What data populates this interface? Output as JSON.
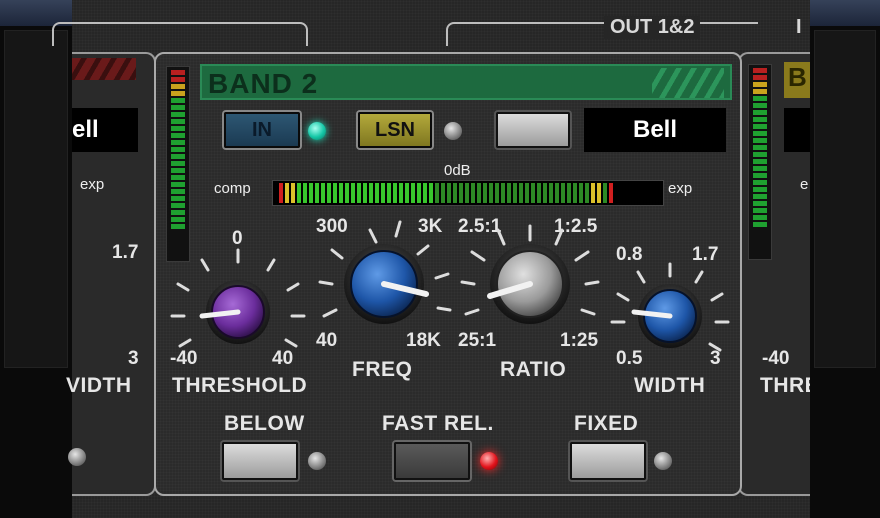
{
  "header": {
    "out_label": "OUT 1&2",
    "next_label_partial": "I"
  },
  "left_band": {
    "mode": "ell",
    "exp_label": "exp",
    "scale_top": "1.7",
    "scale_bottom": "3",
    "name": "VIDTH"
  },
  "right_band": {
    "band_partial": "B",
    "scale_bottom": "-40",
    "name_partial": "THRE",
    "exp_partial": "e"
  },
  "band": {
    "title": "BAND 2",
    "in_label": "IN",
    "lsn_label": "LSN",
    "mode": "Bell",
    "zero_db": "0dB",
    "comp_label": "comp",
    "exp_label": "exp",
    "threshold": {
      "name": "THRESHOLD",
      "top": "0",
      "min": "-40",
      "max": "40"
    },
    "freq": {
      "name": "FREQ",
      "top_left": "300",
      "top_right": "3K",
      "min": "40",
      "max": "18K"
    },
    "ratio": {
      "name": "RATIO",
      "top_left": "2.5:1",
      "top_right": "1:2.5",
      "min": "25:1",
      "max": "1:25"
    },
    "width": {
      "name": "WIDTH",
      "top_left": "0.8",
      "top_right": "1.7",
      "min": "0.5",
      "max": "3"
    },
    "below_label": "BELOW",
    "fast_rel_label": "FAST REL.",
    "fixed_label": "FIXED"
  },
  "colors": {
    "band_header": "#1d6a3f",
    "threshold_knob": "#6b2d9c",
    "freq_knob": "#1e56a8",
    "ratio_knob": "#9a9a9a",
    "width_knob": "#1e56a8",
    "led_in": "#14c7a6",
    "led_fast_rel": "#e3141c"
  }
}
